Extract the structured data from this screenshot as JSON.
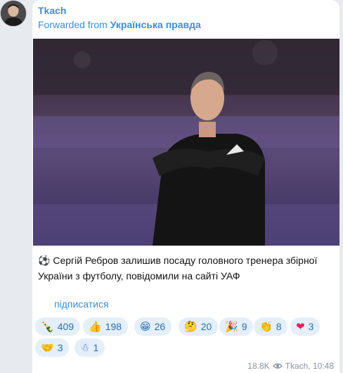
{
  "message": {
    "author": "Tkach",
    "forwarded_prefix": "Forwarded from",
    "forwarded_source": "Українська правда",
    "caption_emoji": "⚽",
    "caption_text": "Сергій Ребров залишив посаду головного тренера збірної України з футболу, повідомили на сайті УАФ",
    "subscribe_link": "підписатися",
    "views": "18.8K",
    "signature": "Tkach, 10:48"
  },
  "reactions": [
    {
      "emoji": "🍾",
      "count": "409"
    },
    {
      "emoji": "👍",
      "count": "198"
    },
    {
      "emoji": "😁",
      "count": "26"
    },
    {
      "emoji": "🤔",
      "count": "20"
    },
    {
      "emoji": "🎉",
      "count": "9"
    },
    {
      "emoji": "👏",
      "count": "8"
    },
    {
      "emoji": "❤",
      "count": "3"
    },
    {
      "emoji": "🤝",
      "count": "3"
    },
    {
      "emoji": "☃",
      "count": "1"
    }
  ],
  "colors": {
    "background": "#e7ebf0",
    "link": "#3a8fd4",
    "reaction_bg": "#e4effa",
    "meta": "#8a949d"
  },
  "icons": [
    "avatar",
    "photo",
    "eye-icon"
  ]
}
